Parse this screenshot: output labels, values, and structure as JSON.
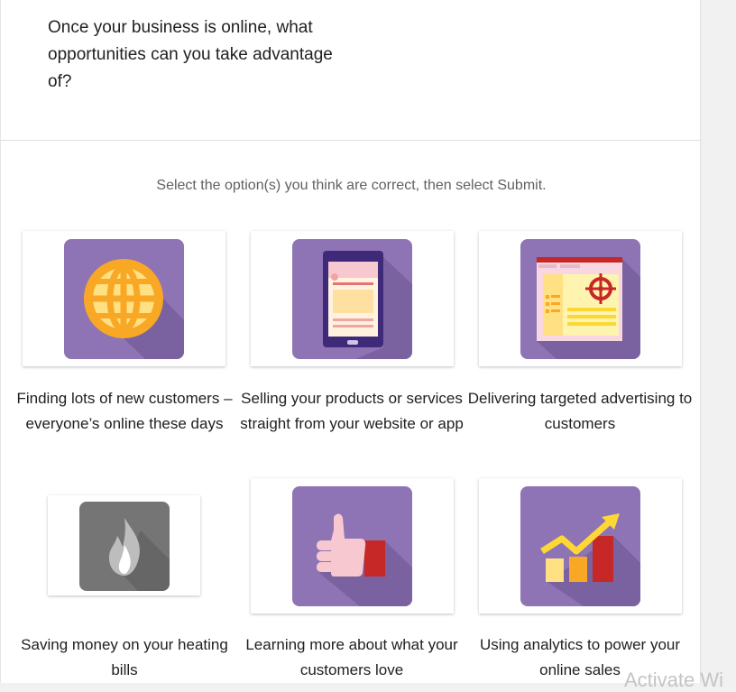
{
  "question": "Once your business is online, what opportunities can you take advantage of?",
  "instruction": "Select the option(s) you think are correct, then select Submit.",
  "colors": {
    "tile": "#8e74b5",
    "tile_shadow": "#7a619f",
    "disabled_tile": "#757575",
    "accent_yellow": "#fdd835",
    "accent_orange": "#f9a825",
    "accent_red": "#c62828",
    "accent_pink": "#f8c8d0"
  },
  "options": [
    {
      "label": "Finding lots of new customers – everyone’s online these days",
      "icon": "globe-icon"
    },
    {
      "label": "Selling your products or services straight from your website or app",
      "icon": "tablet-icon"
    },
    {
      "label": "Delivering targeted advertising to customers",
      "icon": "target-ad-icon"
    },
    {
      "label": "Saving money on your heating bills",
      "icon": "flame-icon"
    },
    {
      "label": "Learning more about what your customers love",
      "icon": "thumbs-up-icon"
    },
    {
      "label": "Using analytics to power your online sales",
      "icon": "analytics-chart-icon"
    }
  ],
  "watermark": "Activate Wi"
}
